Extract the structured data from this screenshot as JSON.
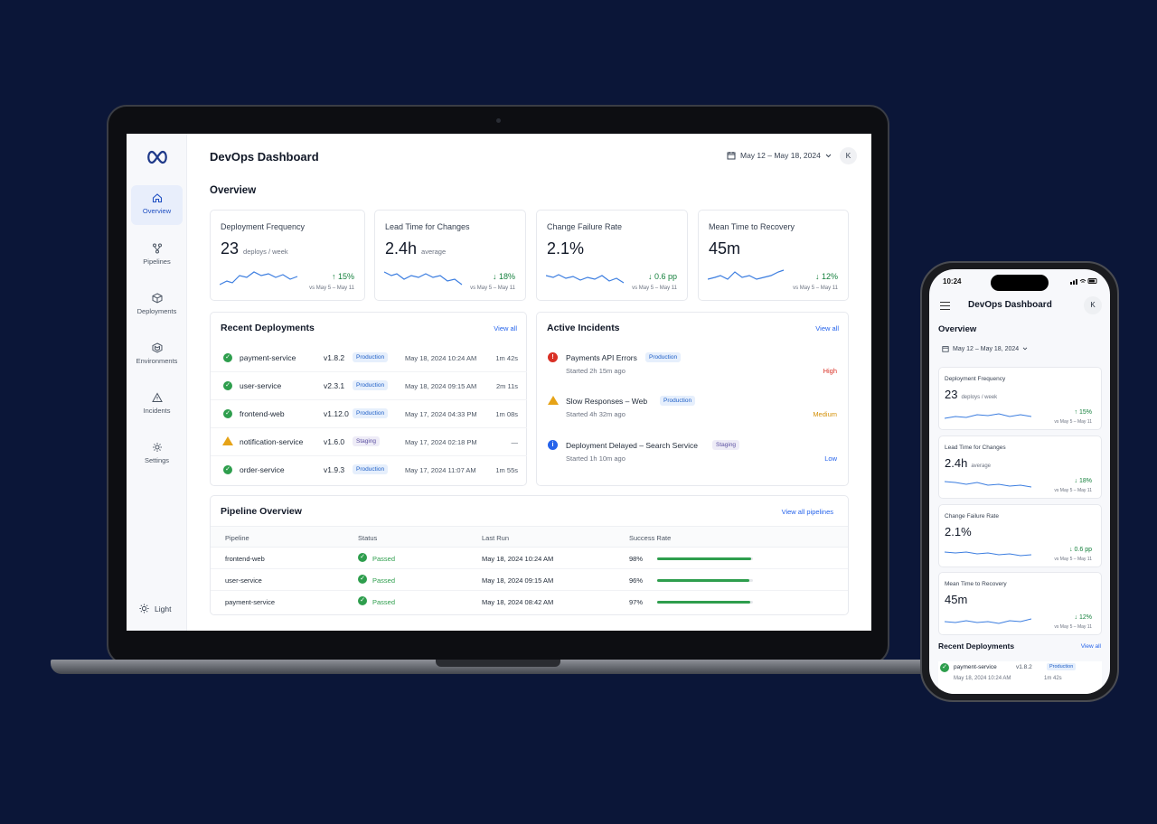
{
  "app": {
    "title": "DevOps Dashboard",
    "date_range": "May 12 – May 18, 2024",
    "avatar": "K"
  },
  "sidebar": {
    "logo": "infinity-icon",
    "items": [
      {
        "label": "Overview",
        "icon": "home-icon",
        "active": true
      },
      {
        "label": "Pipelines",
        "icon": "pipeline-icon"
      },
      {
        "label": "Deployments",
        "icon": "cube-icon"
      },
      {
        "label": "Environments",
        "icon": "layers-icon"
      },
      {
        "label": "Incidents",
        "icon": "warning-icon"
      },
      {
        "label": "Settings",
        "icon": "gear-icon"
      }
    ],
    "theme_label": "Light"
  },
  "overview": {
    "title": "Overview",
    "kpis": [
      {
        "name": "Deployment Frequency",
        "value": "23",
        "unit": "deploys / week",
        "delta": "↑ 15%",
        "compare": "vs May 5 – May 11"
      },
      {
        "name": "Lead Time for Changes",
        "value": "2.4h",
        "unit": "average",
        "delta": "↓ 18%",
        "compare": "vs May 5 – May 11"
      },
      {
        "name": "Change Failure Rate",
        "value": "2.1%",
        "unit": "",
        "delta": "↓ 0.6 pp",
        "compare": "vs May 5 – May 11"
      },
      {
        "name": "Mean Time to Recovery",
        "value": "45m",
        "unit": "",
        "delta": "↓ 12%",
        "compare": "vs May 5 – May 11"
      }
    ]
  },
  "recent_deployments": {
    "title": "Recent Deployments",
    "view_all": "View all",
    "rows": [
      {
        "service": "payment-service",
        "version": "v1.8.2",
        "env": "Production",
        "time": "May 18, 2024 10:24 AM",
        "duration": "1m 42s",
        "status": "success"
      },
      {
        "service": "user-service",
        "version": "v2.3.1",
        "env": "Production",
        "time": "May 18, 2024 09:15 AM",
        "duration": "2m 11s",
        "status": "success"
      },
      {
        "service": "frontend-web",
        "version": "v1.12.0",
        "env": "Production",
        "time": "May 17, 2024 04:33 PM",
        "duration": "1m 08s",
        "status": "success"
      },
      {
        "service": "notification-service",
        "version": "v1.6.0",
        "env": "Staging",
        "time": "May 17, 2024 02:18 PM",
        "duration": "—",
        "status": "warning"
      },
      {
        "service": "order-service",
        "version": "v1.9.3",
        "env": "Production",
        "time": "May 17, 2024 11:07 AM",
        "duration": "1m 55s",
        "status": "success"
      }
    ]
  },
  "active_incidents": {
    "title": "Active Incidents",
    "view_all": "View all",
    "rows": [
      {
        "title": "Payments API Errors",
        "env": "Production",
        "started": "Started 2h 15m ago",
        "severity": "High",
        "color": "#d93025"
      },
      {
        "title": "Slow Responses – Web",
        "env": "Production",
        "started": "Started 4h 32m ago",
        "severity": "Medium",
        "color": "#e6a317"
      },
      {
        "title": "Deployment Delayed – Search Service",
        "env": "Staging",
        "started": "Started 1h 10m ago",
        "severity": "Low",
        "color": "#2563eb"
      }
    ]
  },
  "pipeline_overview": {
    "title": "Pipeline Overview",
    "view_all": "View all pipelines",
    "headers": {
      "pipeline": "Pipeline",
      "status": "Status",
      "last_run": "Last Run",
      "success_rate": "Success Rate"
    },
    "rows": [
      {
        "pipeline": "frontend-web",
        "status": "Passed",
        "last_run": "May 18, 2024 10:24 AM",
        "success_rate": "98%",
        "rate": 0.98
      },
      {
        "pipeline": "user-service",
        "status": "Passed",
        "last_run": "May 18, 2024 09:15 AM",
        "success_rate": "96%",
        "rate": 0.96
      },
      {
        "pipeline": "payment-service",
        "status": "Passed",
        "last_run": "May 18, 2024 08:42 AM",
        "success_rate": "97%",
        "rate": 0.97
      }
    ]
  },
  "phone": {
    "time": "10:24",
    "title": "DevOps Dashboard",
    "avatar": "K",
    "overview": "Overview",
    "date_range": "May 12 – May 18, 2024",
    "kpis": [
      {
        "name": "Deployment Frequency",
        "value": "23",
        "unit": "deploys / week",
        "delta": "↑ 15%",
        "compare": "vs May 5 – May 11"
      },
      {
        "name": "Lead Time for Changes",
        "value": "2.4h",
        "unit": "average",
        "delta": "↓ 18%",
        "compare": "vs May 5 – May 11"
      },
      {
        "name": "Change Failure Rate",
        "value": "2.1%",
        "unit": "",
        "delta": "↓ 0.6 pp",
        "compare": "vs May 5 – May 11"
      },
      {
        "name": "Mean Time to Recovery",
        "value": "45m",
        "unit": "",
        "delta": "↓ 12%",
        "compare": "vs May 5 – May 11"
      }
    ],
    "recent_title": "Recent Deployments",
    "recent_view_all": "View all",
    "recent_row": {
      "service": "payment-service",
      "version": "v1.8.2",
      "env": "Production",
      "time": "May 18, 2024 10:24 AM",
      "duration": "1m 42s"
    }
  },
  "colors": {
    "accent": "#2563eb",
    "success": "#2e9e4d",
    "background": "#0b1638"
  }
}
